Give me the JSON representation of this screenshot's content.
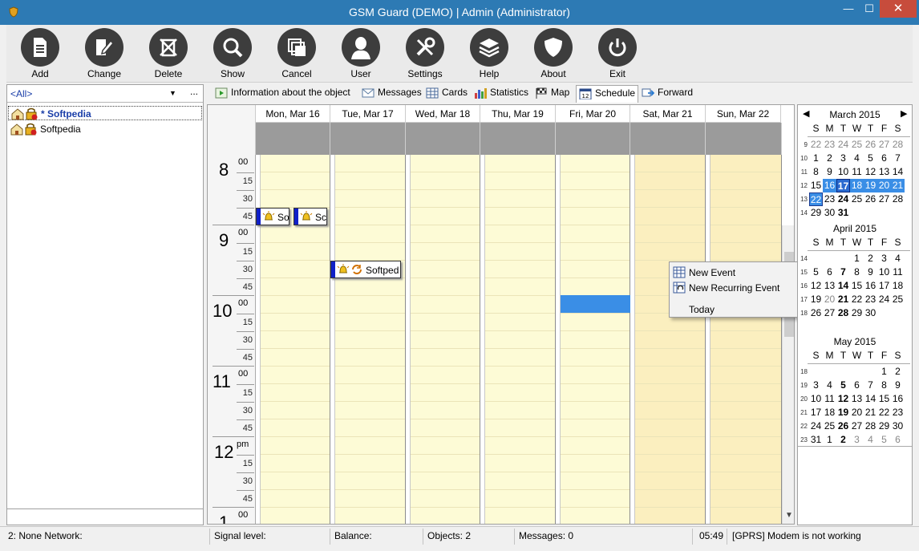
{
  "window": {
    "title": "GSM Guard (DEMO) | Admin (Administrator)",
    "minimize": "—",
    "maximize": "☐",
    "close": "✕"
  },
  "toolbar": {
    "buttons": [
      {
        "label": "Add",
        "icon": "document-icon"
      },
      {
        "label": "Change",
        "icon": "edit-icon"
      },
      {
        "label": "Delete",
        "icon": "delete-icon"
      },
      {
        "label": "Show",
        "icon": "search-icon"
      },
      {
        "label": "Cancel",
        "icon": "cancel-icon"
      },
      {
        "label": "User",
        "icon": "user-icon"
      },
      {
        "label": "Settings",
        "icon": "settings-icon"
      },
      {
        "label": "Help",
        "icon": "layers-icon"
      },
      {
        "label": "About",
        "icon": "shield-icon"
      },
      {
        "label": "Exit",
        "icon": "power-icon"
      }
    ]
  },
  "sidebar": {
    "filter": "<All>",
    "filter_more": "...",
    "items": [
      {
        "label": "* Softpedia"
      },
      {
        "label": "Softpedia"
      }
    ]
  },
  "tabs": [
    {
      "label": "Information about the object"
    },
    {
      "label": "Messages"
    },
    {
      "label": "Cards"
    },
    {
      "label": "Statistics"
    },
    {
      "label": "Map"
    },
    {
      "label": "Schedule"
    },
    {
      "label": "Forward"
    }
  ],
  "schedule": {
    "days": [
      "Mon, Mar 16",
      "Tue, Mar 17",
      "Wed, Mar 18",
      "Thu, Mar 19",
      "Fri, Mar 20",
      "Sat, Mar 21",
      "Sun, Mar 22"
    ],
    "hours": [
      {
        "hour": "8",
        "suffix": "00"
      },
      {
        "hour": "9",
        "suffix": "00"
      },
      {
        "hour": "10",
        "suffix": "00"
      },
      {
        "hour": "11",
        "suffix": "00"
      },
      {
        "hour": "12",
        "suffix": "pm"
      },
      {
        "hour": "1",
        "suffix": "00"
      }
    ],
    "minutes": [
      "15",
      "30",
      "45"
    ],
    "events": [
      {
        "text": "So"
      },
      {
        "text": "Sc"
      },
      {
        "text": "Softped"
      }
    ]
  },
  "context_menu": {
    "items": [
      {
        "label": "New Event"
      },
      {
        "label": "New Recurring Event"
      },
      {
        "label": "Today"
      }
    ]
  },
  "minicalendars": {
    "dow": [
      "S",
      "M",
      "T",
      "W",
      "T",
      "F",
      "S"
    ],
    "prev": "◀",
    "next": "▶",
    "months": [
      {
        "title": "March 2015",
        "weeks": [
          {
            "num": "9",
            "days": [
              "22",
              "23",
              "24",
              "25",
              "26",
              "27",
              "28"
            ]
          },
          {
            "num": "10",
            "days": [
              "1",
              "2",
              "3",
              "4",
              "5",
              "6",
              "7"
            ]
          },
          {
            "num": "11",
            "days": [
              "8",
              "9",
              "10",
              "11",
              "12",
              "13",
              "14"
            ]
          },
          {
            "num": "12",
            "days": [
              "15",
              "16",
              "17",
              "18",
              "19",
              "20",
              "21"
            ]
          },
          {
            "num": "13",
            "days": [
              "22",
              "23",
              "24",
              "25",
              "26",
              "27",
              "28"
            ]
          },
          {
            "num": "14",
            "days": [
              "29",
              "30",
              "31",
              "",
              "",
              "",
              ""
            ]
          }
        ]
      },
      {
        "title": "April 2015",
        "weeks": [
          {
            "num": "14",
            "days": [
              "",
              "",
              "",
              "1",
              "2",
              "3",
              "4"
            ]
          },
          {
            "num": "15",
            "days": [
              "5",
              "6",
              "7",
              "8",
              "9",
              "10",
              "11"
            ]
          },
          {
            "num": "16",
            "days": [
              "12",
              "13",
              "14",
              "15",
              "16",
              "17",
              "18"
            ]
          },
          {
            "num": "17",
            "days": [
              "19",
              "20",
              "21",
              "22",
              "23",
              "24",
              "25"
            ]
          },
          {
            "num": "18",
            "days": [
              "26",
              "27",
              "28",
              "29",
              "30",
              "",
              ""
            ]
          }
        ]
      },
      {
        "title": "May 2015",
        "weeks": [
          {
            "num": "18",
            "days": [
              "",
              "",
              "",
              "",
              "",
              "1",
              "2"
            ]
          },
          {
            "num": "19",
            "days": [
              "3",
              "4",
              "5",
              "6",
              "7",
              "8",
              "9"
            ]
          },
          {
            "num": "20",
            "days": [
              "10",
              "11",
              "12",
              "13",
              "14",
              "15",
              "16"
            ]
          },
          {
            "num": "21",
            "days": [
              "17",
              "18",
              "19",
              "20",
              "21",
              "22",
              "23"
            ]
          },
          {
            "num": "22",
            "days": [
              "24",
              "25",
              "26",
              "27",
              "28",
              "29",
              "30"
            ]
          },
          {
            "num": "23",
            "days": [
              "31",
              "1",
              "2",
              "3",
              "4",
              "5",
              "6"
            ]
          }
        ]
      }
    ]
  },
  "statusbar": {
    "network": "2: None Network:",
    "signal": "Signal level:",
    "balance": "Balance:",
    "objects": "Objects: 2",
    "messages": "Messages: 0",
    "time": "05:49",
    "modem": "[GPRS] Modem is not working"
  },
  "colors": {
    "titlebar": "#2d7ab4",
    "accent": "#3a8ee6",
    "day_bg": "#fdfbd6",
    "weekend_bg": "#fbefbf",
    "event_bar": "#1020c8"
  }
}
